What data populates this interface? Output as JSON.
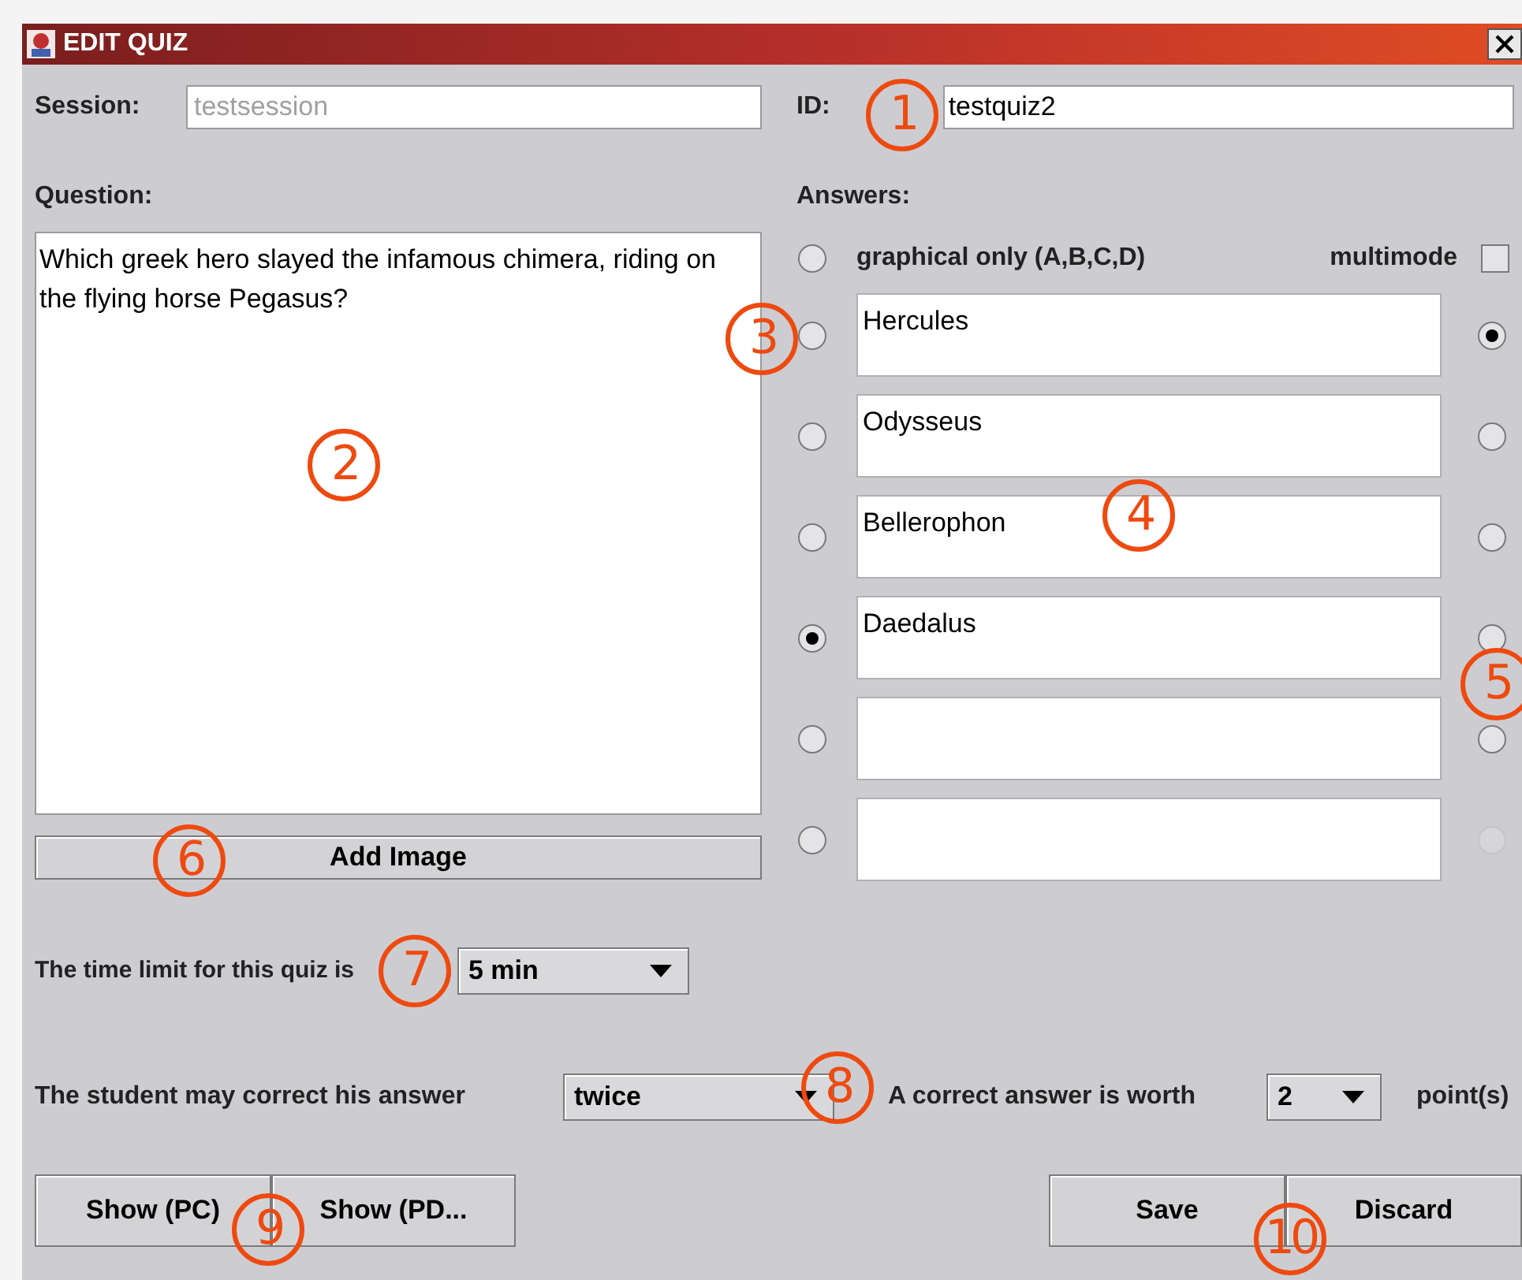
{
  "window": {
    "title": "EDIT QUIZ"
  },
  "session": {
    "label": "Session:",
    "value": "testsession"
  },
  "id": {
    "label": "ID:",
    "value": "testquiz2"
  },
  "question": {
    "label": "Question:",
    "value": "Which greek hero slayed the infamous chimera, riding on the flying horse Pegasus?"
  },
  "add_image_button": "Add Image",
  "answers": {
    "label": "Answers:",
    "graphical_only": {
      "label": "graphical only (A,B,C,D)",
      "selected": false
    },
    "multimode": {
      "label": "multimode",
      "checked": false
    },
    "items": [
      {
        "text": "Hercules",
        "selected": false,
        "right_selected": true,
        "right_disabled": false
      },
      {
        "text": "Odysseus",
        "selected": false,
        "right_selected": false,
        "right_disabled": false
      },
      {
        "text": "Bellerophon",
        "selected": false,
        "right_selected": false,
        "right_disabled": false
      },
      {
        "text": "Daedalus",
        "selected": true,
        "right_selected": false,
        "right_disabled": false
      },
      {
        "selected": false,
        "right_selected": false,
        "right_disabled": false
      },
      {
        "selected": false,
        "right_selected": false,
        "right_disabled": true
      }
    ]
  },
  "time_limit": {
    "label": "The time limit for this quiz is",
    "value": "5 min"
  },
  "corrections": {
    "label": "The student may correct his answer",
    "value": "twice"
  },
  "worth": {
    "label": "A correct answer is worth",
    "value": "2",
    "unit": "point(s)"
  },
  "buttons_left": [
    "Show (PC)",
    "Show (PD..."
  ],
  "buttons_right": [
    "Save",
    "Discard"
  ],
  "callouts": [
    "1",
    "2",
    "3",
    "4",
    "5",
    "6",
    "7",
    "8",
    "9",
    "10"
  ]
}
